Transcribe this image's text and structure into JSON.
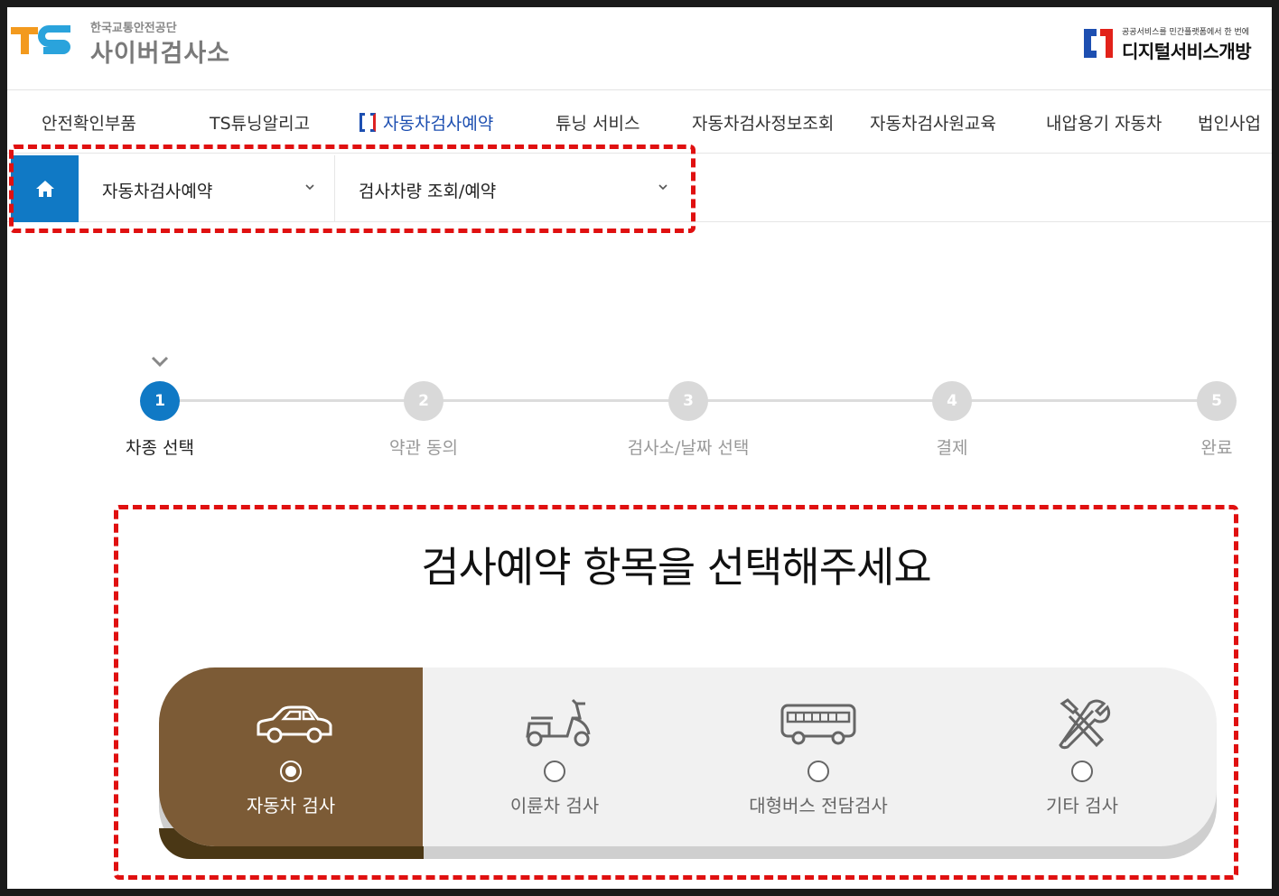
{
  "header": {
    "org_name": "한국교통안전공단",
    "site_name": "사이버검사소",
    "logo_text": "TS",
    "right_logo_small": "공공서비스를 민간플랫폼에서 한 번에",
    "right_logo_big": "디지털서비스개방"
  },
  "gnb": {
    "items": [
      {
        "label": "안전확인부품"
      },
      {
        "label": "TS튜닝알리고"
      },
      {
        "label": "자동차검사예약"
      },
      {
        "label": "튜닝 서비스"
      },
      {
        "label": "자동차검사정보조회"
      },
      {
        "label": "자동차검사원교육"
      },
      {
        "label": "내압용기 자동차"
      },
      {
        "label": "법인사업"
      }
    ],
    "active_index": 2
  },
  "location": {
    "home_icon": "home-icon",
    "depth1": "자동차검사예약",
    "depth2": "검사차량 조회/예약"
  },
  "steps": [
    {
      "number": "1",
      "label": "차종 선택",
      "active": true
    },
    {
      "number": "2",
      "label": "약관 동의"
    },
    {
      "number": "3",
      "label": "검사소/날짜 선택"
    },
    {
      "number": "4",
      "label": "결제"
    },
    {
      "number": "5",
      "label": "완료"
    }
  ],
  "selection": {
    "title": "검사예약 항목을 선택해주세요",
    "options": [
      {
        "label": "자동차 검사",
        "icon": "car-icon",
        "selected": true
      },
      {
        "label": "이륜차 검사",
        "icon": "scooter-icon"
      },
      {
        "label": "대형버스 전담검사",
        "icon": "bus-icon"
      },
      {
        "label": "기타 검사",
        "icon": "tools-icon"
      }
    ]
  },
  "colors": {
    "primary": "#1079c5",
    "selected_tab": "#7c5b36",
    "highlight_border": "#e01010"
  }
}
